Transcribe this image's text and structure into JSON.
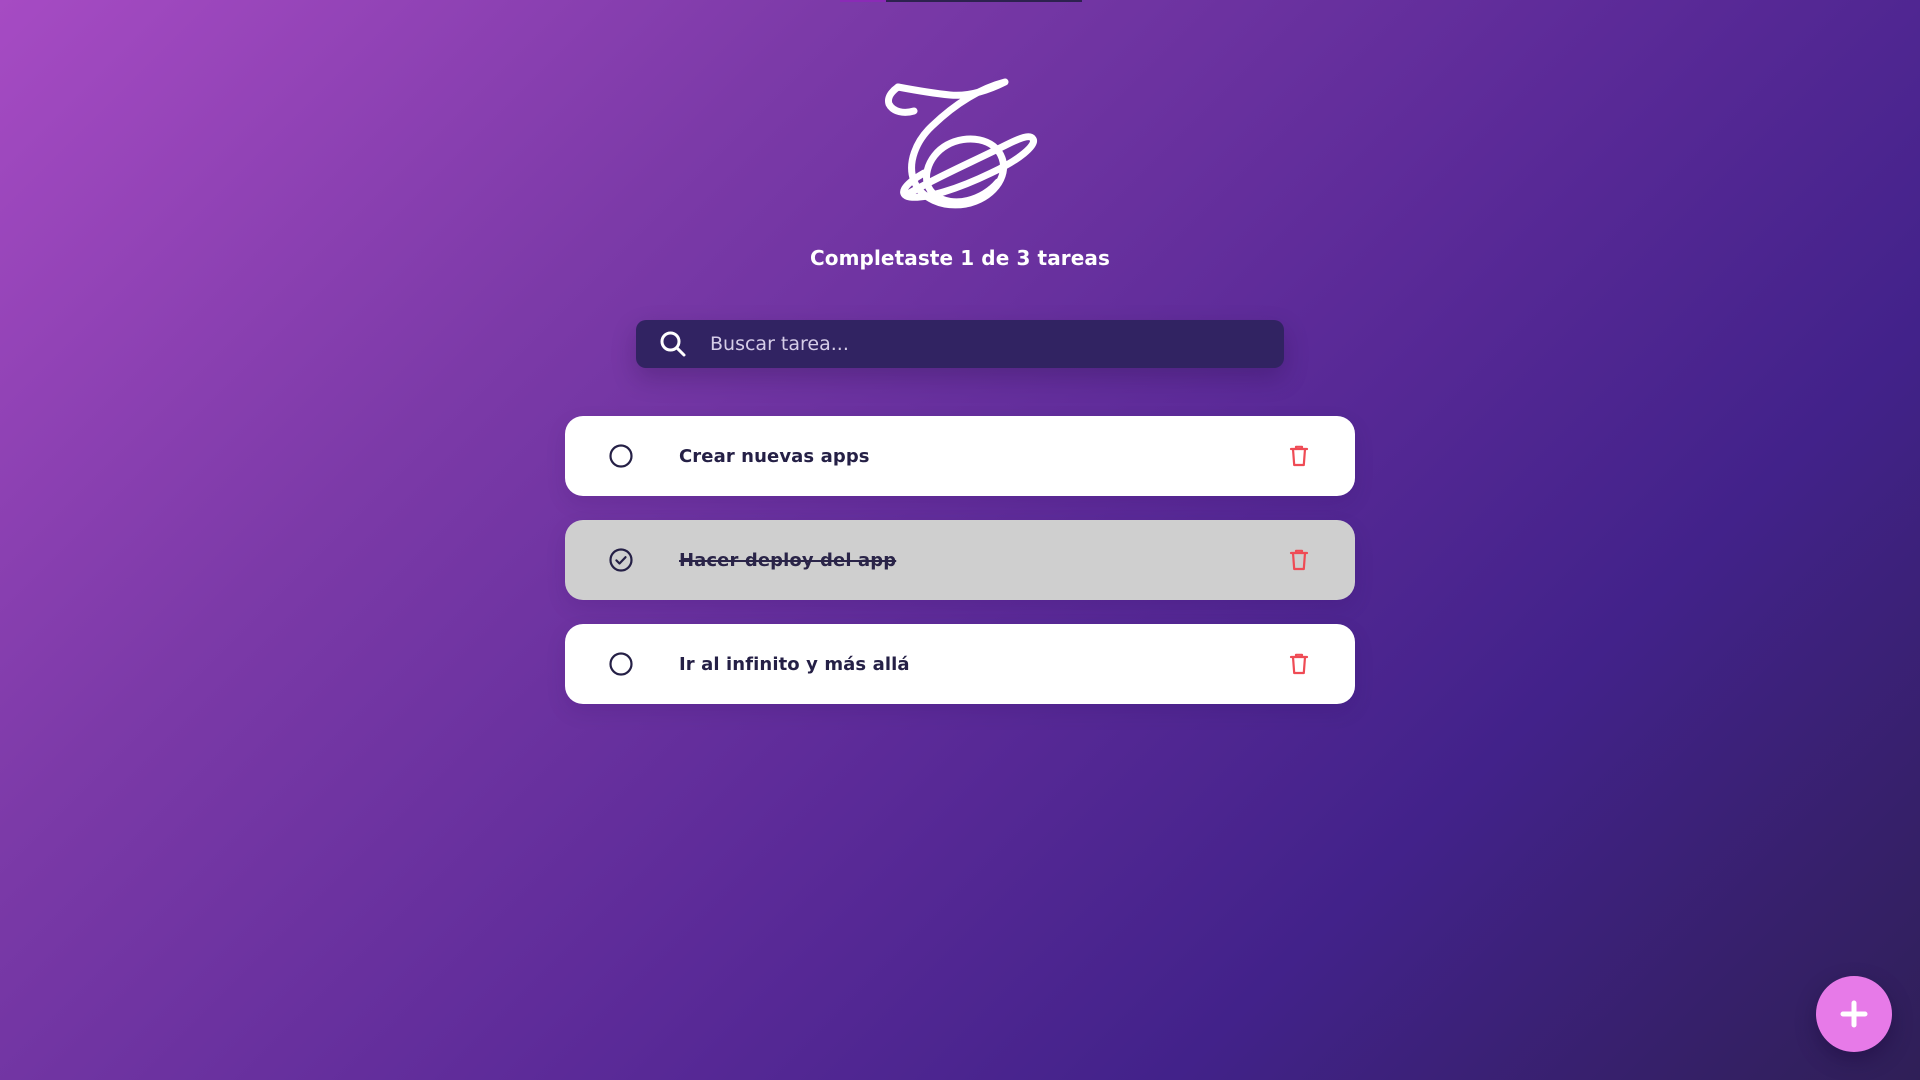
{
  "header": {
    "counter_text": "Completaste 1 de 3 tareas"
  },
  "search": {
    "placeholder": "Buscar tarea..."
  },
  "tasks": [
    {
      "text": "Crear nuevas apps",
      "completed": false
    },
    {
      "text": "Hacer deploy del app",
      "completed": true
    },
    {
      "text": "Ir al infinito y más allá",
      "completed": false
    }
  ],
  "icons": {
    "logo": "planet-logo-icon",
    "search": "search-icon",
    "unchecked": "circle-icon",
    "checked": "check-circle-icon",
    "delete": "trash-icon",
    "add": "plus-icon"
  },
  "colors": {
    "card": "#ffffff",
    "completed_card": "#cfcfcf",
    "search_bg": "#312362",
    "delete": "#ef4b55",
    "fab": "#e77ae8",
    "text": "#252046"
  }
}
